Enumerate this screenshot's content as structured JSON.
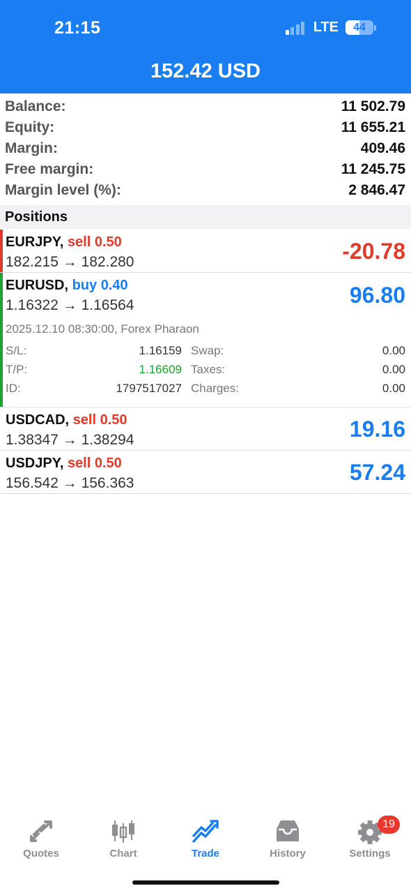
{
  "status": {
    "time": "21:15",
    "network": "LTE",
    "battery": "44"
  },
  "header": {
    "title": "152.42 USD"
  },
  "summary": [
    {
      "label": "Balance:",
      "value": "11 502.79"
    },
    {
      "label": "Equity:",
      "value": "11 655.21"
    },
    {
      "label": "Margin:",
      "value": "409.46"
    },
    {
      "label": "Free margin:",
      "value": "11 245.75"
    },
    {
      "label": "Margin level (%):",
      "value": "2 846.47"
    }
  ],
  "positions_header": "Positions",
  "positions": [
    {
      "symbol": "EURJPY,",
      "direction": "sell 0.50",
      "prices": "182.215 → 182.280",
      "profit": "-20.78",
      "bar_color": "#e03a2b"
    },
    {
      "symbol": "EURUSD,",
      "direction": "buy 0.40",
      "prices": "1.16322 → 1.16564",
      "profit": "96.80",
      "bar_color": "#1aa32e",
      "details": {
        "date": "2025.12.10 08:30:00, Forex Pharaon",
        "sl_label": "S/L:",
        "sl": "1.16159",
        "swap_label": "Swap:",
        "swap": "0.00",
        "tp_label": "T/P:",
        "tp": "1.16609",
        "taxes_label": "Taxes:",
        "taxes": "0.00",
        "id_label": "ID:",
        "id": "1797517027",
        "charges_label": "Charges:",
        "charges": "0.00"
      }
    },
    {
      "symbol": "USDCAD,",
      "direction": "sell 0.50",
      "prices": "1.38347 → 1.38294",
      "profit": "19.16"
    },
    {
      "symbol": "USDJPY,",
      "direction": "sell 0.50",
      "prices": "156.542 → 156.363",
      "profit": "57.24"
    }
  ],
  "tabs": [
    {
      "label": "Quotes",
      "icon": "quotes-arrows-icon"
    },
    {
      "label": "Chart",
      "icon": "candlestick-icon"
    },
    {
      "label": "Trade",
      "icon": "trade-trend-icon",
      "active": true
    },
    {
      "label": "History",
      "icon": "inbox-tray-icon"
    },
    {
      "label": "Settings",
      "icon": "gear-icon",
      "badge": "19"
    }
  ],
  "colors": {
    "accent": "#1a7df2",
    "sell": "#e03a2b",
    "buy": "#1a7df2",
    "positive": "#1aa32e",
    "badge": "#e8372c"
  }
}
